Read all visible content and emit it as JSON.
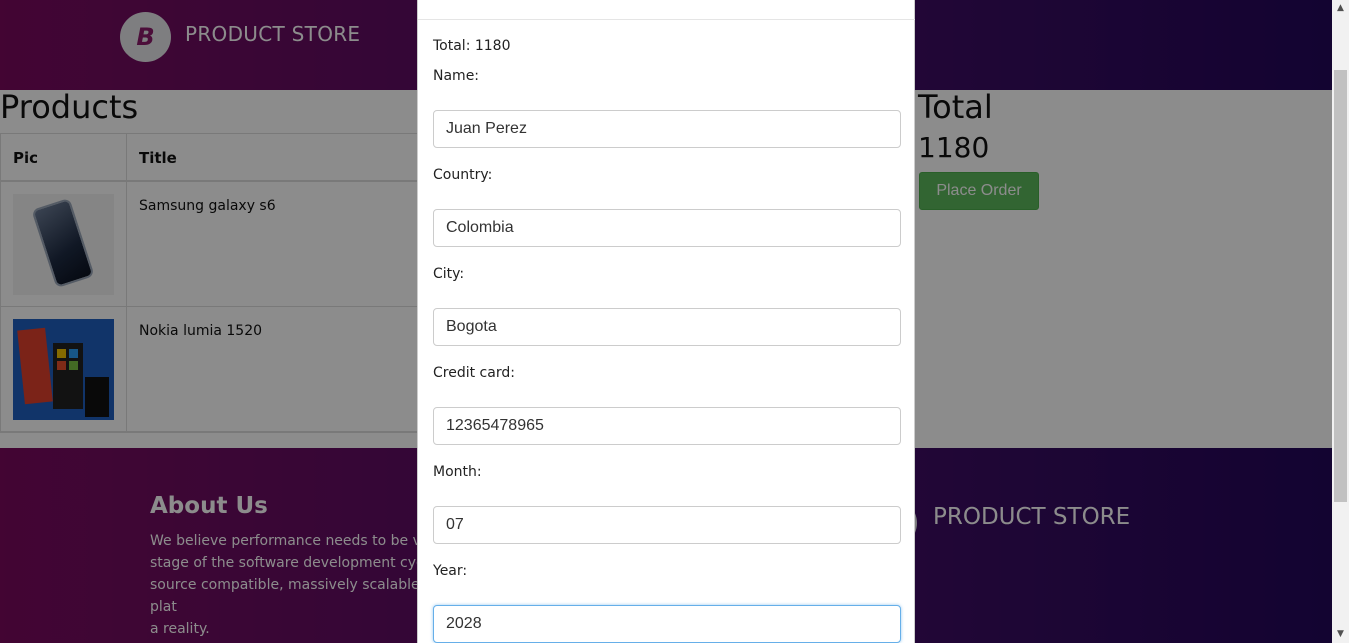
{
  "navbar": {
    "brand_logo_letter": "B",
    "brand_name": "PRODUCT STORE"
  },
  "products": {
    "title": "Products",
    "columns": [
      "Pic",
      "Title"
    ],
    "rows": [
      {
        "title": "Samsung galaxy s6",
        "image": "samsung-galaxy-s6-image"
      },
      {
        "title": "Nokia lumia 1520",
        "image": "nokia-lumia-1520-image"
      }
    ]
  },
  "cart": {
    "total_heading": "Total",
    "total_value": "1180",
    "place_order_label": "Place Order"
  },
  "footer": {
    "about_title": "About Us",
    "about_text": "We believe performance needs to be valid\nstage of the software development cycle a\nsource compatible, massively scalable plat\na reality.",
    "brand_name": "PRODUCT STORE"
  },
  "modal": {
    "total_label": "Total: 1180",
    "fields": {
      "name": {
        "label": "Name:",
        "value": "Juan Perez"
      },
      "country": {
        "label": "Country:",
        "value": "Colombia"
      },
      "city": {
        "label": "City:",
        "value": "Bogota"
      },
      "card": {
        "label": "Credit card:",
        "value": "12365478965"
      },
      "month": {
        "label": "Month:",
        "value": "07"
      },
      "year": {
        "label": "Year:",
        "value": "2028"
      }
    }
  },
  "scrollbar": {
    "up_arrow": "▲",
    "down_arrow": "▼"
  },
  "colors": {
    "accent_green": "#5cb85c",
    "nav_gradient_start": "#7a0a5e",
    "nav_gradient_end": "#23085a",
    "focus_border": "#66afe9"
  }
}
